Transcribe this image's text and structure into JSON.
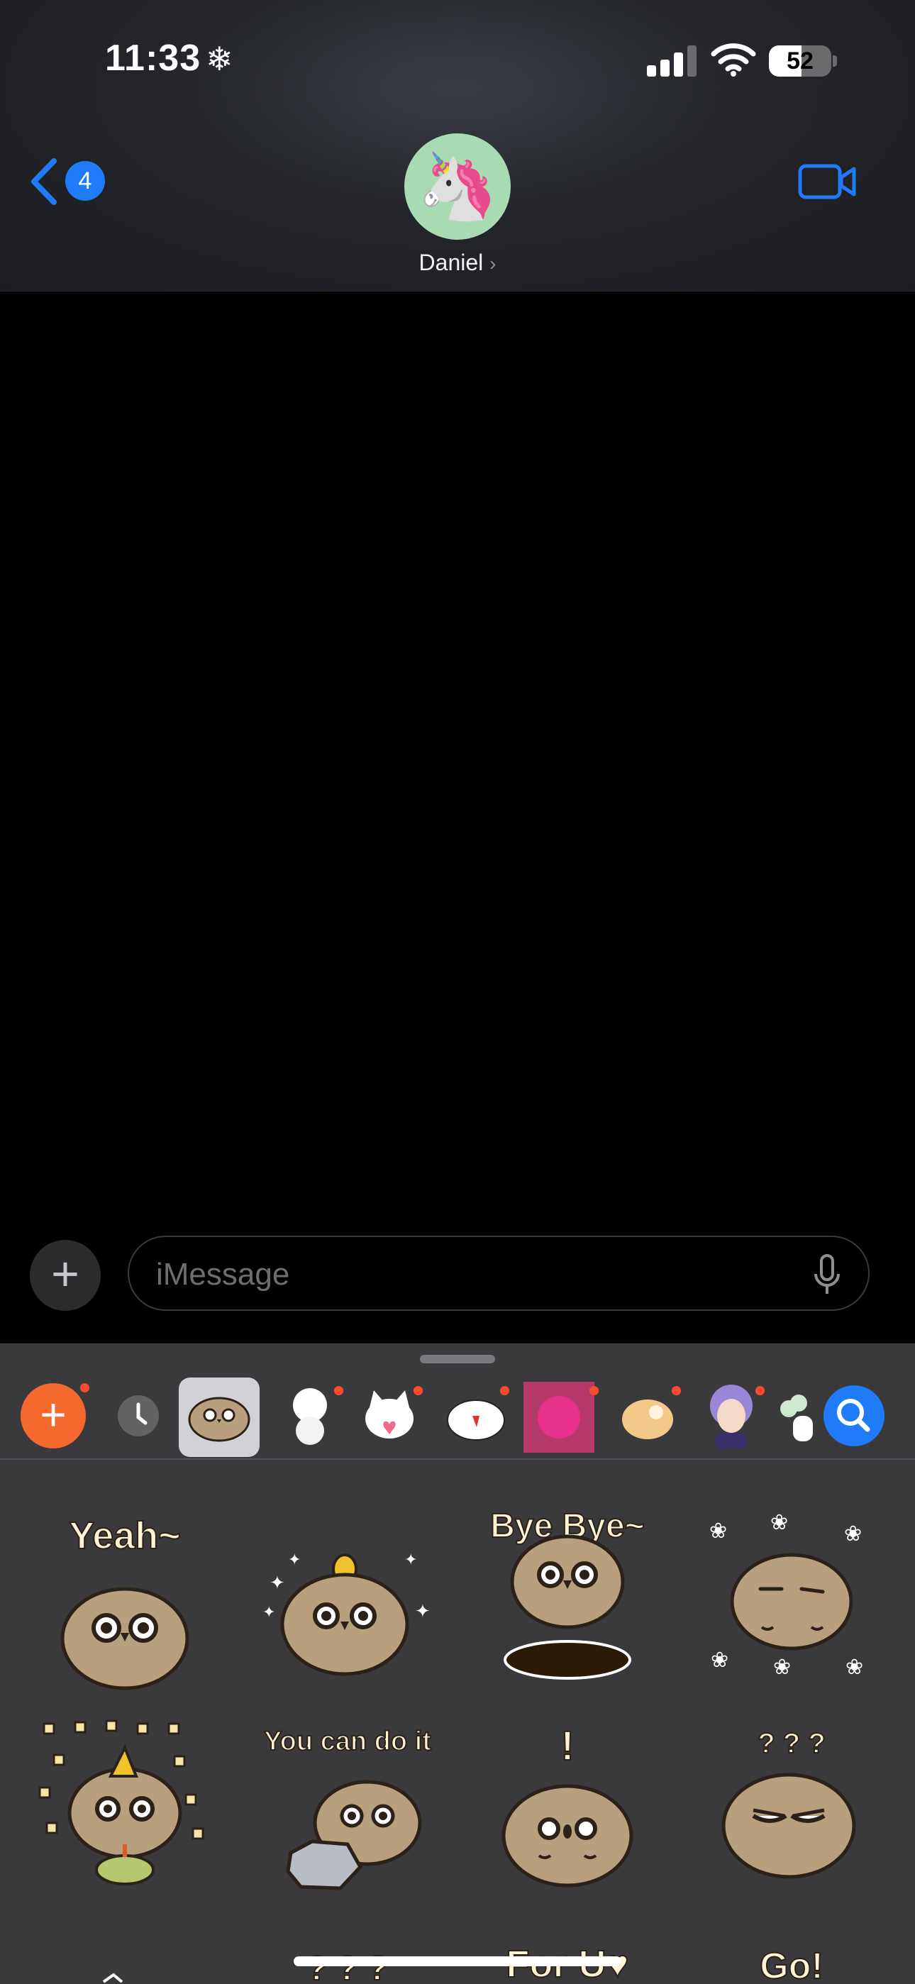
{
  "status_bar": {
    "time": "11:33",
    "weather_glyph": "❄",
    "battery_level": "52",
    "battery_fraction": 0.52,
    "signal_bars": 3
  },
  "nav": {
    "back_badge": "4",
    "avatar_emoji": "🦄",
    "contact_name": "Daniel",
    "chevron": "›"
  },
  "composer": {
    "plus_glyph": "+",
    "placeholder": "iMessage"
  },
  "tray": {
    "add_glyph": "+",
    "items": [
      "add-app",
      "recents",
      "owl-stickers",
      "white-character",
      "cat-stickers",
      "rabbit-stickers",
      "pink-photo",
      "hamster-stickers",
      "girl-stickers",
      "clover-stickers",
      "search"
    ]
  },
  "stickers": {
    "captions": [
      "Yeah~",
      "Bye Bye~",
      "You can do it",
      "!",
      "? ? ?",
      "? ? ?",
      "For U♥",
      "Go!"
    ]
  },
  "colors": {
    "accent_blue": "#1f7bf7",
    "add_orange": "#f5682e",
    "drawer_bg": "#3a3a3c",
    "owl_body": "#b89f7d"
  }
}
